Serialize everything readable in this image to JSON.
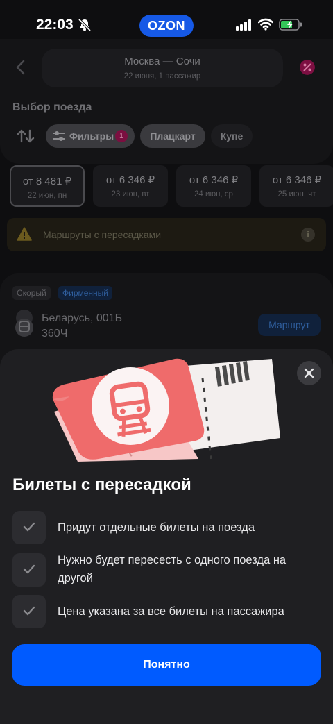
{
  "status_bar": {
    "time": "22:03",
    "logo": "OZON"
  },
  "header": {
    "route": "Москва — Сочи",
    "details": "22 июня, 1 пассажир",
    "section_title": "Выбор поезда",
    "filters_label": "Фильтры",
    "filters_count": "1",
    "chips": [
      "Плацкарт",
      "Купе"
    ]
  },
  "dates": [
    {
      "price": "от 8 481 ₽",
      "day": "22 июн, пн",
      "selected": true
    },
    {
      "price": "от 6 346 ₽",
      "day": "23 июн, вт",
      "selected": false
    },
    {
      "price": "от 6 346 ₽",
      "day": "24 июн, ср",
      "selected": false
    },
    {
      "price": "от 6 346 ₽",
      "day": "25 июн, чт",
      "selected": false
    }
  ],
  "transfer_banner": {
    "text": "Маршруты с пересадками",
    "info": "i"
  },
  "train": {
    "tags": [
      "Скорый",
      "Фирменный"
    ],
    "name": "Беларусь, 001Б",
    "number": "360Ч",
    "route_button": "Маршрут"
  },
  "sheet": {
    "title": "Билеты с пересадкой",
    "points": [
      "Придут отдельные билеты на поезда",
      "Нужно будет пересесть с одного поезда на другой",
      "Цена указана за все билеты на пассажира"
    ],
    "button": "Понятно"
  },
  "colors": {
    "accent": "#005bff",
    "brand_pink": "#f1117e",
    "ticket": "#f26a6a"
  }
}
